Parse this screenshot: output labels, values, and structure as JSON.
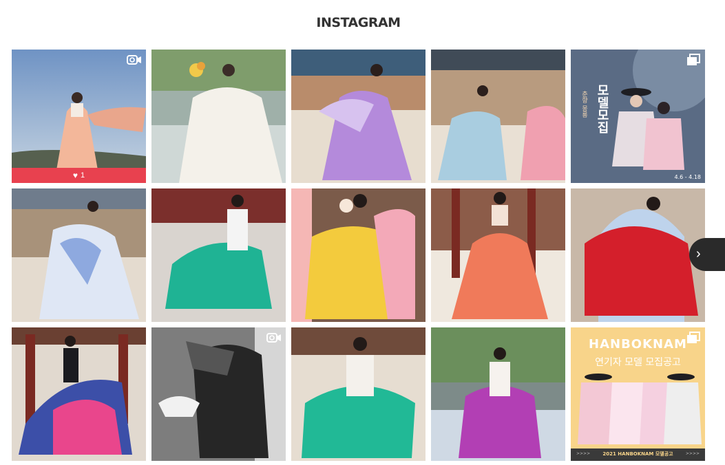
{
  "header": {
    "title": "INSTAGRAM"
  },
  "tiles": [
    {
      "alt": "hanbok-peach",
      "badge": "video",
      "likes": "1"
    },
    {
      "alt": "hanbok-white-pond",
      "badge": ""
    },
    {
      "alt": "hanbok-lavender",
      "badge": ""
    },
    {
      "alt": "hanbok-blue-pink",
      "badge": ""
    },
    {
      "alt": "model-recruit-poster",
      "badge": "carousel",
      "poster_text": "모델모집",
      "poster_sub": "춘향 몽룡",
      "poster_date": "4.6 - 4.18"
    },
    {
      "alt": "hanbok-light-blue",
      "badge": ""
    },
    {
      "alt": "hanbok-teal",
      "badge": ""
    },
    {
      "alt": "hanbok-yellow",
      "badge": ""
    },
    {
      "alt": "hanbok-coral",
      "badge": ""
    },
    {
      "alt": "hanbok-red-arch",
      "badge": ""
    },
    {
      "alt": "hanbok-multicolor",
      "badge": ""
    },
    {
      "alt": "hanbok-black-white",
      "badge": "video"
    },
    {
      "alt": "hanbok-teal-back",
      "badge": ""
    },
    {
      "alt": "hanbok-magenta",
      "badge": ""
    },
    {
      "alt": "hanboknam-poster",
      "badge": "carousel",
      "poster_brand": "HANBOKNAM",
      "poster_line": "연기자 모델 모집공고",
      "poster_footer": "2021 HANBOKNAM 모델공고",
      "poster_arrows_left": ">>>>",
      "poster_arrows_right": ">>>>"
    }
  ],
  "colors": {
    "like_bar": "#e8414f",
    "next_button": "#2a2a2a"
  },
  "icons": {
    "video": "video-camera-icon",
    "carousel": "multiple-images-icon",
    "like": "heart-icon",
    "next": "chevron-right-icon"
  },
  "nav": {
    "next_glyph": "›"
  }
}
